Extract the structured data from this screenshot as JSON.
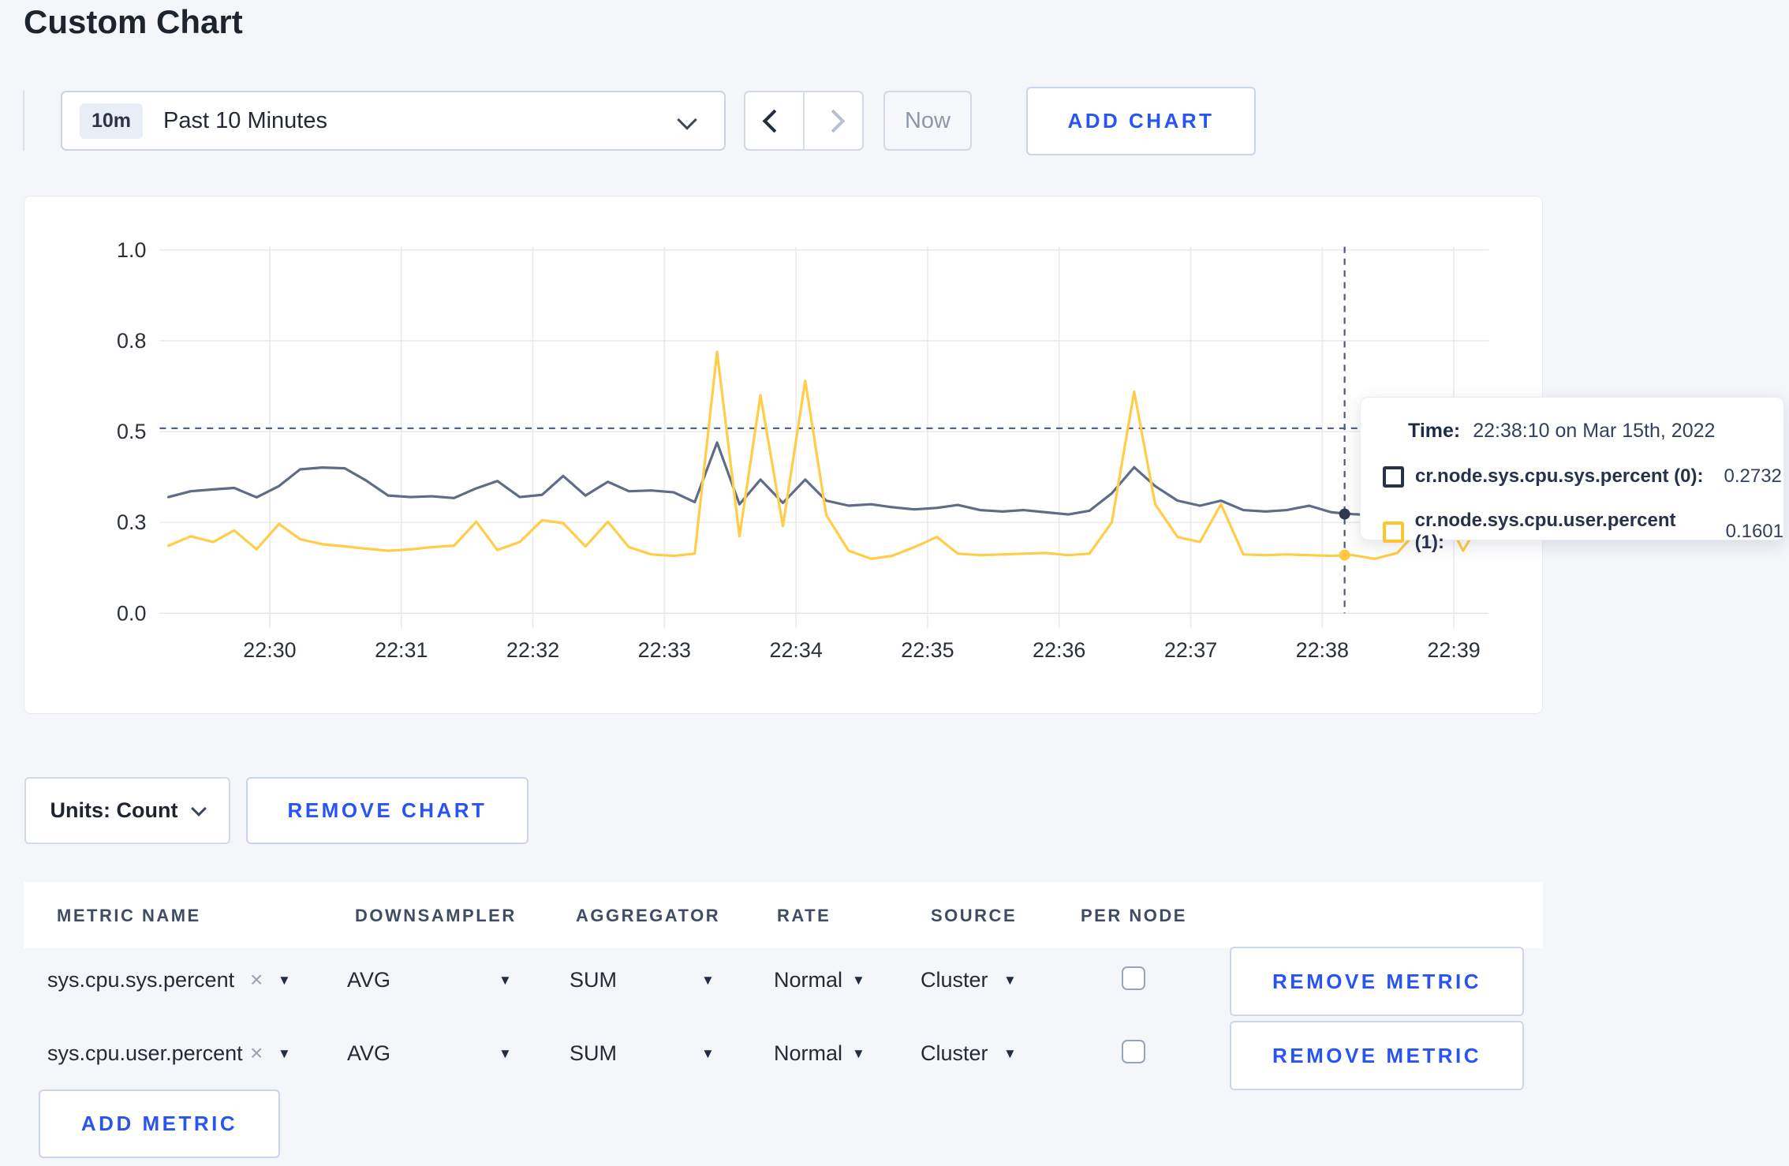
{
  "page": {
    "title": "Custom Chart",
    "background": "#f4f6fa",
    "accent_blue": "#2954f4"
  },
  "toolbar": {
    "range_badge": "10m",
    "range_label": "Past 10 Minutes",
    "now_label": "Now",
    "add_chart_label": "ADD CHART"
  },
  "icons": {
    "time_dropdown": "chevron-down",
    "prev": "chevron-left",
    "next": "chevron-right",
    "remove_x": "×",
    "triangle_down": "▼"
  },
  "tooltip": {
    "time_label": "Time:",
    "time_value": "22:38:10 on Mar 15th, 2022",
    "rows": [
      {
        "label": "cr.node.sys.cpu.sys.percent (0):",
        "value": "0.2732",
        "swatch_color": "#273149"
      },
      {
        "label": "cr.node.sys.cpu.user.percent (1):",
        "value": "0.1601",
        "swatch_color": "#ffc52f"
      }
    ]
  },
  "units_row": {
    "units_label": "Units: Count",
    "remove_chart_label": "REMOVE CHART"
  },
  "metrics_table": {
    "headers": [
      "METRIC NAME",
      "DOWNSAMPLER",
      "AGGREGATOR",
      "RATE",
      "SOURCE",
      "PER NODE"
    ],
    "rows": [
      {
        "metric": "sys.cpu.sys.percent",
        "downsampler": "AVG",
        "aggregator": "SUM",
        "rate": "Normal",
        "source": "Cluster",
        "per_node": false,
        "remove_label": "REMOVE METRIC"
      },
      {
        "metric": "sys.cpu.user.percent",
        "downsampler": "AVG",
        "aggregator": "SUM",
        "rate": "Normal",
        "source": "Cluster",
        "per_node": false,
        "remove_label": "REMOVE METRIC"
      }
    ],
    "add_metric_label": "ADD METRIC"
  },
  "chart_data": {
    "type": "line",
    "title": "",
    "xlabel": "",
    "ylabel": "",
    "grid": true,
    "x_axis": {
      "tick_labels": [
        "22:30",
        "22:31",
        "22:32",
        "22:33",
        "22:34",
        "22:35",
        "22:36",
        "22:37",
        "22:38",
        "22:39"
      ],
      "tick_minutes": [
        30,
        31,
        32,
        33,
        34,
        35,
        36,
        37,
        38,
        39
      ],
      "domain_minutes": [
        29.2,
        39.35
      ]
    },
    "y_axis": {
      "tick_labels": [
        "0.0",
        "0.3",
        "0.5",
        "0.8",
        "1.0"
      ],
      "tick_values": [
        0,
        0.25,
        0.5,
        0.75,
        1.0
      ],
      "range": [
        0,
        1
      ]
    },
    "series": [
      {
        "name": "cr.node.sys.cpu.sys.percent (0)",
        "color": "#5f6c87",
        "points": [
          [
            29.23,
            0.32
          ],
          [
            29.4,
            0.336
          ],
          [
            29.57,
            0.341
          ],
          [
            29.73,
            0.345
          ],
          [
            29.9,
            0.319
          ],
          [
            30.07,
            0.35
          ],
          [
            30.23,
            0.396
          ],
          [
            30.4,
            0.401
          ],
          [
            30.57,
            0.399
          ],
          [
            30.73,
            0.366
          ],
          [
            30.9,
            0.324
          ],
          [
            31.07,
            0.32
          ],
          [
            31.23,
            0.322
          ],
          [
            31.4,
            0.317
          ],
          [
            31.57,
            0.344
          ],
          [
            31.73,
            0.364
          ],
          [
            31.9,
            0.32
          ],
          [
            32.07,
            0.326
          ],
          [
            32.23,
            0.378
          ],
          [
            32.4,
            0.324
          ],
          [
            32.57,
            0.362
          ],
          [
            32.73,
            0.336
          ],
          [
            32.9,
            0.338
          ],
          [
            33.07,
            0.333
          ],
          [
            33.23,
            0.306
          ],
          [
            33.4,
            0.47
          ],
          [
            33.57,
            0.3
          ],
          [
            33.73,
            0.368
          ],
          [
            33.9,
            0.304
          ],
          [
            34.07,
            0.368
          ],
          [
            34.23,
            0.31
          ],
          [
            34.4,
            0.296
          ],
          [
            34.57,
            0.3
          ],
          [
            34.73,
            0.292
          ],
          [
            34.9,
            0.286
          ],
          [
            35.07,
            0.29
          ],
          [
            35.23,
            0.298
          ],
          [
            35.4,
            0.284
          ],
          [
            35.57,
            0.28
          ],
          [
            35.73,
            0.284
          ],
          [
            35.9,
            0.278
          ],
          [
            36.07,
            0.272
          ],
          [
            36.23,
            0.282
          ],
          [
            36.4,
            0.33
          ],
          [
            36.57,
            0.402
          ],
          [
            36.73,
            0.35
          ],
          [
            36.9,
            0.31
          ],
          [
            37.07,
            0.296
          ],
          [
            37.23,
            0.31
          ],
          [
            37.4,
            0.284
          ],
          [
            37.57,
            0.28
          ],
          [
            37.73,
            0.284
          ],
          [
            37.9,
            0.296
          ],
          [
            38.07,
            0.278
          ],
          [
            38.23,
            0.273
          ],
          [
            38.4,
            0.27
          ],
          [
            38.57,
            0.272
          ],
          [
            38.73,
            0.284
          ],
          [
            38.9,
            0.298
          ],
          [
            39.07,
            0.286
          ],
          [
            39.23,
            0.276
          ]
        ]
      },
      {
        "name": "cr.node.sys.cpu.user.percent (1)",
        "color": "#ffcd47",
        "points": [
          [
            29.23,
            0.186
          ],
          [
            29.4,
            0.212
          ],
          [
            29.57,
            0.196
          ],
          [
            29.73,
            0.228
          ],
          [
            29.9,
            0.176
          ],
          [
            30.07,
            0.246
          ],
          [
            30.23,
            0.204
          ],
          [
            30.4,
            0.19
          ],
          [
            30.57,
            0.184
          ],
          [
            30.73,
            0.178
          ],
          [
            30.9,
            0.172
          ],
          [
            31.07,
            0.176
          ],
          [
            31.23,
            0.182
          ],
          [
            31.4,
            0.186
          ],
          [
            31.57,
            0.252
          ],
          [
            31.73,
            0.174
          ],
          [
            31.9,
            0.196
          ],
          [
            32.07,
            0.256
          ],
          [
            32.23,
            0.248
          ],
          [
            32.4,
            0.184
          ],
          [
            32.57,
            0.252
          ],
          [
            32.73,
            0.182
          ],
          [
            32.9,
            0.162
          ],
          [
            33.07,
            0.158
          ],
          [
            33.23,
            0.164
          ],
          [
            33.4,
            0.72
          ],
          [
            33.57,
            0.212
          ],
          [
            33.73,
            0.6
          ],
          [
            33.9,
            0.24
          ],
          [
            34.07,
            0.64
          ],
          [
            34.23,
            0.27
          ],
          [
            34.4,
            0.172
          ],
          [
            34.57,
            0.15
          ],
          [
            34.73,
            0.158
          ],
          [
            34.9,
            0.182
          ],
          [
            35.07,
            0.21
          ],
          [
            35.23,
            0.164
          ],
          [
            35.4,
            0.16
          ],
          [
            35.57,
            0.162
          ],
          [
            35.73,
            0.164
          ],
          [
            35.9,
            0.166
          ],
          [
            36.07,
            0.16
          ],
          [
            36.23,
            0.164
          ],
          [
            36.4,
            0.25
          ],
          [
            36.57,
            0.61
          ],
          [
            36.73,
            0.3
          ],
          [
            36.9,
            0.21
          ],
          [
            37.07,
            0.196
          ],
          [
            37.23,
            0.3
          ],
          [
            37.4,
            0.162
          ],
          [
            37.57,
            0.16
          ],
          [
            37.73,
            0.162
          ],
          [
            37.9,
            0.16
          ],
          [
            38.07,
            0.158
          ],
          [
            38.23,
            0.16
          ],
          [
            38.4,
            0.15
          ],
          [
            38.57,
            0.166
          ],
          [
            38.73,
            0.23
          ],
          [
            38.9,
            0.295
          ],
          [
            39.07,
            0.172
          ],
          [
            39.23,
            0.27
          ]
        ]
      }
    ],
    "hover": {
      "time_label": "22:38:10 on Mar 15th, 2022",
      "time_min": 38.17,
      "values": [
        0.2732,
        0.1601
      ],
      "dot_colors": [
        "#2c3a55",
        "#ffc83d"
      ],
      "guideline_value": 0.509
    },
    "legend_position": "tooltip"
  }
}
